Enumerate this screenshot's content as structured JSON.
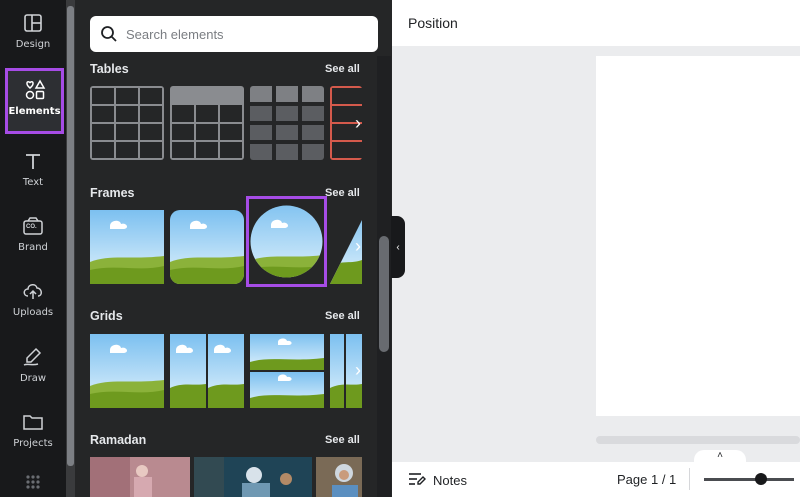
{
  "rail": {
    "design": "Design",
    "elements": "Elements",
    "text": "Text",
    "brand": "Brand",
    "brand_badge": "CO.",
    "uploads": "Uploads",
    "draw": "Draw",
    "projects": "Projects"
  },
  "search": {
    "placeholder": "Search elements"
  },
  "sections": {
    "tables": {
      "title": "Tables",
      "see_all": "See all"
    },
    "frames": {
      "title": "Frames",
      "see_all": "See all"
    },
    "grids": {
      "title": "Grids",
      "see_all": "See all"
    },
    "ramadan": {
      "title": "Ramadan",
      "see_all": "See all"
    }
  },
  "editor": {
    "toolbar_title": "Position",
    "notes_label": "Notes",
    "page_indicator": "Page 1 / 1"
  },
  "colors": {
    "accent": "#a64ce6",
    "sky": "#a8d4f5",
    "grass": "#6e9a1e"
  },
  "icons": [
    "design-icon",
    "elements-icon",
    "text-icon",
    "brand-icon",
    "uploads-icon",
    "draw-icon",
    "projects-icon",
    "apps-grid-icon",
    "search-icon",
    "notes-icon",
    "chevron-up-icon",
    "chevron-right-icon",
    "chevron-left-icon"
  ]
}
